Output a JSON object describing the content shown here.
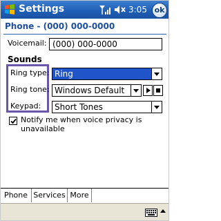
{
  "titlebar": {
    "title": "Settings",
    "time": "3:05",
    "ok_label": "ok",
    "icons": [
      "windows-logo-icon",
      "signal-icon",
      "speaker-icon"
    ]
  },
  "page": {
    "title": "Phone - (000) 000-0000"
  },
  "voicemail": {
    "label": "Voicemail:",
    "value": "(000) 000-0000"
  },
  "sounds": {
    "heading": "Sounds",
    "ring_type": {
      "label": "Ring type:",
      "value": "Ring"
    },
    "ring_tone": {
      "label": "Ring tone:",
      "value": "Windows Default"
    },
    "keypad": {
      "label": "Keypad:",
      "value": "Short Tones"
    }
  },
  "privacy": {
    "checked": true,
    "label": "Notify me when voice privacy is unavailable"
  },
  "tabs": [
    {
      "label": "Phone",
      "active": true
    },
    {
      "label": "Services",
      "active": false
    },
    {
      "label": "More",
      "active": false
    }
  ],
  "colors": {
    "titlebar": "#1f5fb6",
    "selection": "#1f55c8",
    "highlight_box": "#6a56a8",
    "page_title": "#1d4e9e"
  }
}
